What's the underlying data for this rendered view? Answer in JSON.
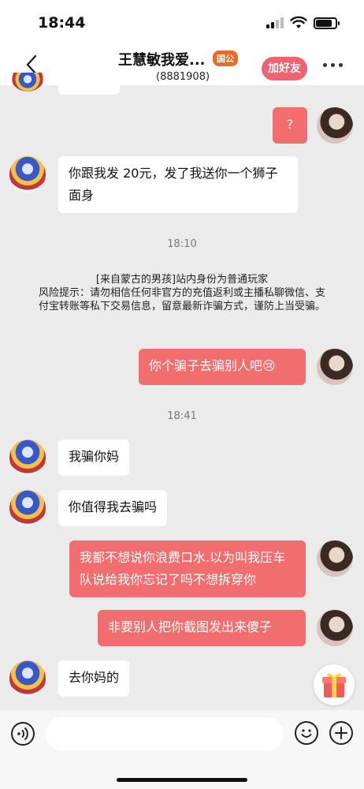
{
  "status_bar": {
    "time": "18:44"
  },
  "header": {
    "title": "王慧敏我爱...",
    "badge": "国公",
    "subtitle": "(8881908)",
    "add_friend": "加好友"
  },
  "messages": [
    {
      "side": "right",
      "text": "?"
    },
    {
      "side": "left",
      "text": "你跟我发 20元，发了我送你一个狮子面身"
    },
    {
      "type": "time",
      "text": "18:10"
    },
    {
      "type": "notice",
      "lines": [
        "[来自蒙古的男孩]站内身份为普通玩家",
        "风险提示：请勿相信任何非官方的充值返利或主播私聊微信、支付宝转账等私下交易信息，留意最新诈骗方式，谨防上当受骗。"
      ]
    },
    {
      "side": "right",
      "text": "你个骗子去骗别人吧😢"
    },
    {
      "type": "time",
      "text": "18:41"
    },
    {
      "side": "left",
      "text": "我骗你妈"
    },
    {
      "side": "left",
      "text": "你值得我去骗吗"
    },
    {
      "side": "right",
      "text": "我都不想说你浪费口水.以为叫我压车队说给我你忘记了吗不想拆穿你"
    },
    {
      "side": "right",
      "text": "非要别人把你截图发出来傻子"
    },
    {
      "side": "left",
      "text": "去你妈的"
    }
  ],
  "input": {
    "placeholder": ""
  },
  "icons": {
    "back": "chevron-left-icon",
    "more": "more-dots-icon",
    "gift": "gift-icon",
    "voice": "voice-icon",
    "emoji": "emoji-icon",
    "plus": "plus-icon"
  },
  "colors": {
    "accent": "#f06272",
    "bubble_right": "#f26d6d",
    "background": "#ebebeb"
  }
}
